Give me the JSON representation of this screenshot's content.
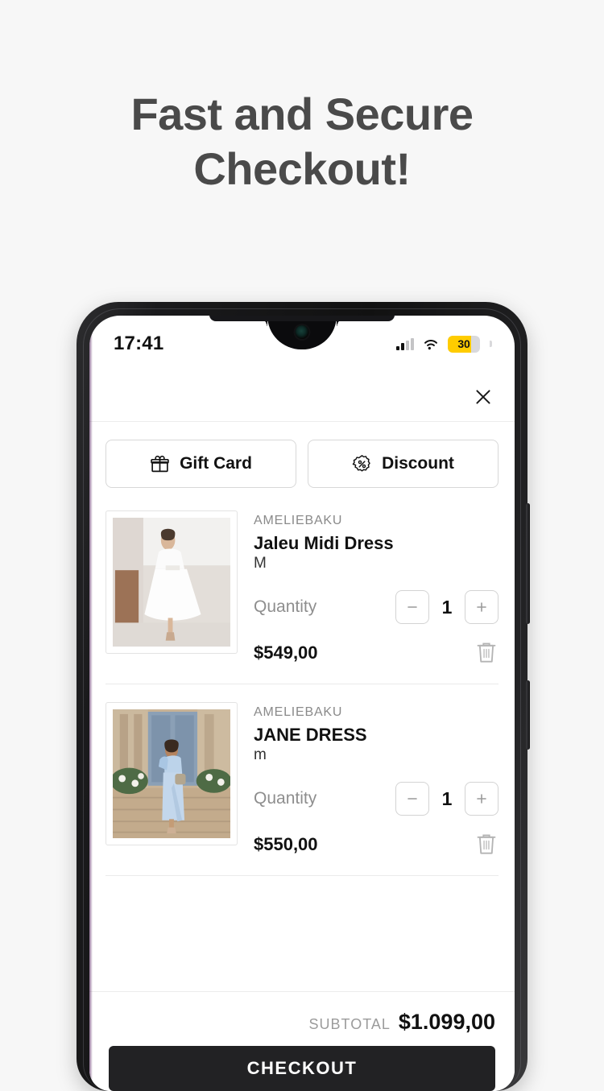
{
  "headline": {
    "line1": "Fast and Secure",
    "line2": "Checkout!"
  },
  "status_bar": {
    "time": "17:41",
    "battery_percent": "30",
    "signal_icon": "cellular-signal-icon",
    "wifi_icon": "wifi-icon",
    "battery_icon": "battery-icon"
  },
  "app": {
    "close_icon": "close-icon",
    "promos": [
      {
        "label": "Gift Card",
        "icon": "gift-icon"
      },
      {
        "label": "Discount",
        "icon": "discount-badge-icon"
      }
    ],
    "quantity_label": "Quantity",
    "decrement_icon": "minus-icon",
    "increment_icon": "plus-icon",
    "remove_icon": "trash-icon",
    "items": [
      {
        "brand": "AMELIEBAKU",
        "title": "Jaleu Midi Dress",
        "variant": "M",
        "quantity": "1",
        "price": "$549,00",
        "image_alt": "white-midi-dress-photo"
      },
      {
        "brand": "AMELIEBAKU",
        "title": "JANE DRESS",
        "variant": "m",
        "quantity": "1",
        "price": "$550,00",
        "image_alt": "light-blue-dress-photo"
      }
    ],
    "footer": {
      "subtotal_label": "SUBTOTAL",
      "subtotal_value": "$1.099,00",
      "checkout_label": "CHECKOUT"
    }
  },
  "colors": {
    "page_background": "#f7f7f7",
    "headline": "#4a4a4a",
    "checkout_button": "#222224",
    "battery_fill": "#ffcc00",
    "muted_text": "#8e8e8e"
  }
}
